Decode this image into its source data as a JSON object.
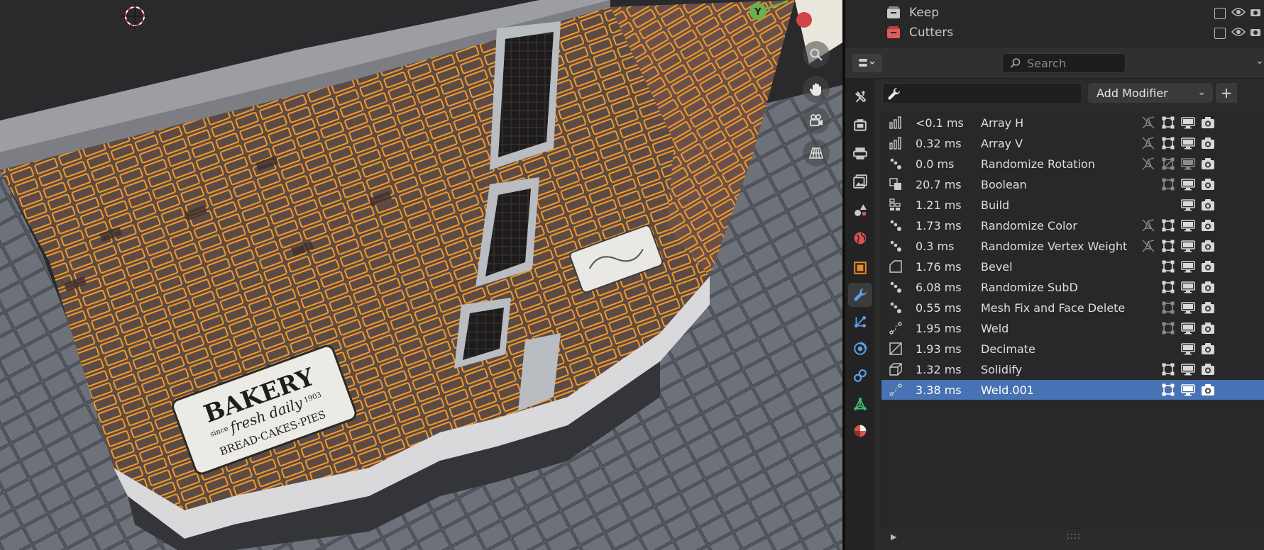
{
  "viewport": {
    "gizmo_y_label": "Y",
    "sign_text": {
      "main": "BAKERY",
      "since": "since",
      "year": "1903",
      "tagline": "fresh daily",
      "subline": "BREAD·CAKES·PIES"
    }
  },
  "outliner": {
    "items": [
      {
        "label": "Keep",
        "icon": "collection-icon"
      },
      {
        "label": "Cutters",
        "icon": "collection-icon"
      }
    ]
  },
  "properties": {
    "search_placeholder": "Search",
    "add_modifier_label": "Add Modifier",
    "add_plus": "+",
    "grip": "::::",
    "modifiers": [
      {
        "time": "<0.1 ms",
        "name": "Array H",
        "icon": "array-icon",
        "toggles": [
          "editmode-off",
          "cage",
          "realtime",
          "render"
        ]
      },
      {
        "time": "0.32 ms",
        "name": "Array V",
        "icon": "array-icon",
        "toggles": [
          "editmode-off",
          "cage",
          "realtime",
          "render"
        ]
      },
      {
        "time": "0.0 ms",
        "name": "Randomize Rotation",
        "icon": "nodes-icon",
        "toggles": [
          "editmode-off",
          "cage-off",
          "realtime-off",
          "render"
        ]
      },
      {
        "time": "20.7 ms",
        "name": "Boolean",
        "icon": "boolean-icon",
        "toggles": [
          "cage-dim",
          "realtime",
          "render"
        ]
      },
      {
        "time": "1.21 ms",
        "name": "Build",
        "icon": "build-icon",
        "toggles": [
          "realtime",
          "render"
        ]
      },
      {
        "time": "1.73 ms",
        "name": "Randomize Color",
        "icon": "nodes-icon",
        "toggles": [
          "editmode-off",
          "cage",
          "realtime",
          "render"
        ]
      },
      {
        "time": "0.3 ms",
        "name": "Randomize Vertex Weight",
        "icon": "nodes-icon",
        "toggles": [
          "editmode-off",
          "cage",
          "realtime",
          "render"
        ]
      },
      {
        "time": "1.76 ms",
        "name": "Bevel",
        "icon": "bevel-icon",
        "toggles": [
          "cage",
          "realtime",
          "render"
        ]
      },
      {
        "time": "6.08 ms",
        "name": "Randomize SubD",
        "icon": "nodes-icon",
        "toggles": [
          "cage",
          "realtime",
          "render"
        ]
      },
      {
        "time": "0.55 ms",
        "name": "Mesh Fix and Face Delete",
        "icon": "nodes-icon",
        "toggles": [
          "cage-dim",
          "realtime",
          "render"
        ]
      },
      {
        "time": "1.95 ms",
        "name": "Weld",
        "icon": "weld-icon",
        "toggles": [
          "cage-dim",
          "realtime",
          "render"
        ]
      },
      {
        "time": "1.93 ms",
        "name": "Decimate",
        "icon": "decimate-icon",
        "toggles": [
          "realtime",
          "render"
        ]
      },
      {
        "time": "1.32 ms",
        "name": "Solidify",
        "icon": "solidify-icon",
        "toggles": [
          "cage",
          "realtime",
          "render"
        ]
      },
      {
        "time": "3.38 ms",
        "name": "Weld.001",
        "icon": "weld-icon",
        "toggles": [
          "cage",
          "realtime",
          "render"
        ],
        "selected": true
      }
    ],
    "tabs": [
      {
        "name": "tool-icon",
        "color": "#c9c9c9"
      },
      {
        "name": "render-icon",
        "color": "#c9c9c9"
      },
      {
        "name": "output-icon",
        "color": "#c9c9c9"
      },
      {
        "name": "view-layer-icon",
        "color": "#c9c9c9"
      },
      {
        "name": "scene-icon",
        "color": "#c9c9c9"
      },
      {
        "name": "world-icon",
        "color": "#d9534f"
      },
      {
        "name": "object-icon",
        "color": "#e88a2b"
      },
      {
        "name": "modifier-icon",
        "color": "#5aa0e8",
        "active": true
      },
      {
        "name": "particles-icon",
        "color": "#5aa0e8"
      },
      {
        "name": "physics-icon",
        "color": "#5aa0e8"
      },
      {
        "name": "constraints-icon",
        "color": "#5aa0e8"
      },
      {
        "name": "data-icon",
        "color": "#3fb86f"
      },
      {
        "name": "material-icon",
        "color": "#d9534f"
      }
    ]
  },
  "colors": {
    "selection": "#4772b3",
    "accent_orange": "#f29b2a"
  }
}
